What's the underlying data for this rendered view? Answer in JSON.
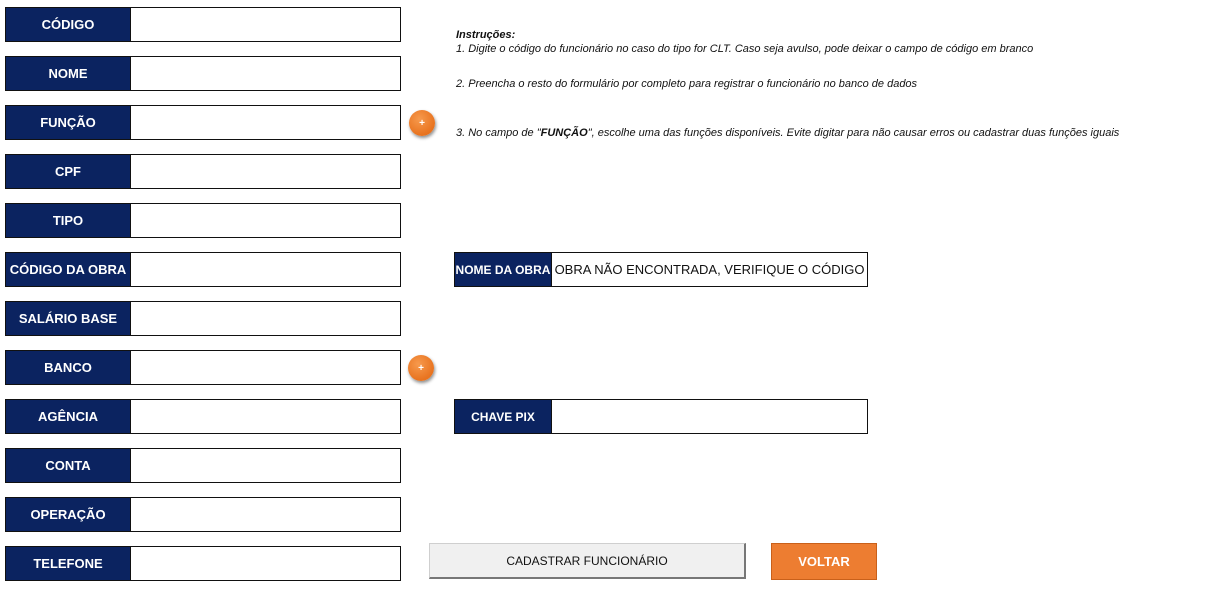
{
  "form": {
    "fields": [
      {
        "label": "CÓDIGO",
        "value": ""
      },
      {
        "label": "NOME",
        "value": ""
      },
      {
        "label": "FUNÇÃO",
        "value": ""
      },
      {
        "label": "CPF",
        "value": ""
      },
      {
        "label": "TIPO",
        "value": ""
      },
      {
        "label": "CÓDIGO DA OBRA",
        "value": ""
      },
      {
        "label": "SALÁRIO BASE",
        "value": ""
      },
      {
        "label": "BANCO",
        "value": ""
      },
      {
        "label": "AGÊNCIA",
        "value": ""
      },
      {
        "label": "CONTA",
        "value": ""
      },
      {
        "label": "OPERAÇÃO",
        "value": ""
      },
      {
        "label": "TELEFONE",
        "value": ""
      }
    ],
    "add_funcao_label": "+",
    "add_banco_label": "+"
  },
  "instructions": {
    "title": "Instruções:",
    "line1": "1. Digite o código do funcionário no caso do tipo for CLT. Caso seja avulso, pode deixar o campo de código em branco",
    "line2": "2. Preencha o resto do formulário por completo para registrar o funcionário no banco de dados",
    "line3_pre": "3. No campo de \"",
    "line3_bold": "FUNÇÃO",
    "line3_post": "\", escolhe uma das funções disponíveis. Evite digitar para não causar erros ou cadastrar duas funções iguais"
  },
  "nome_obra": {
    "label": "NOME DA OBRA",
    "value": "OBRA NÃO ENCONTRADA, VERIFIQUE O CÓDIGO"
  },
  "chave_pix": {
    "label": "CHAVE PIX",
    "value": ""
  },
  "buttons": {
    "cadastrar": "CADASTRAR FUNCIONÁRIO",
    "voltar": "VOLTAR"
  },
  "colors": {
    "label_bg": "#0b2360",
    "accent_orange": "#ed7d31"
  }
}
